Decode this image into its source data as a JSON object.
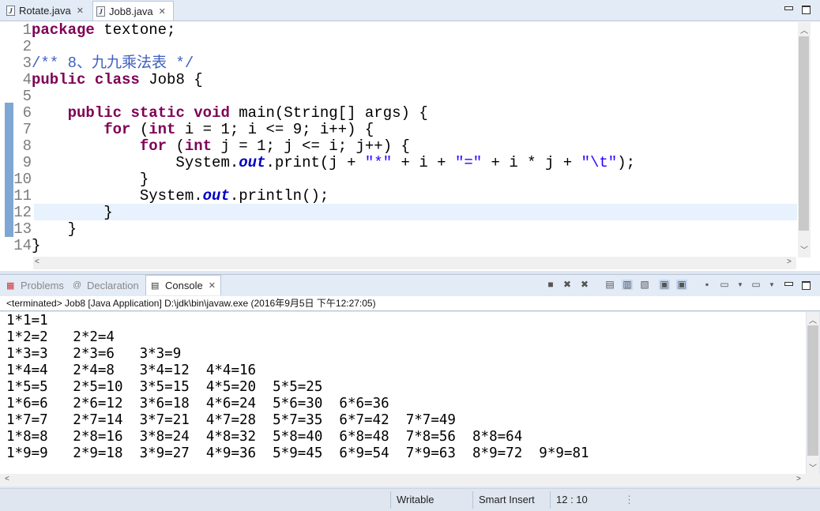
{
  "editor": {
    "tabs": [
      {
        "label": "Rotate.java",
        "icon": "java-file-icon",
        "active": false
      },
      {
        "label": "Job8.java",
        "icon": "java-file-icon",
        "active": true
      }
    ],
    "close_glyph": "✕",
    "line_numbers": [
      "1",
      "2",
      "3",
      "4",
      "5",
      "6",
      "7",
      "8",
      "9",
      "10",
      "11",
      "12",
      "13",
      "14"
    ],
    "cursor_line": 12
  },
  "console": {
    "tabs": [
      {
        "label": "Problems",
        "icon": "problems-icon"
      },
      {
        "label": "Declaration",
        "icon": "declaration-icon"
      },
      {
        "label": "Console",
        "icon": "console-icon"
      }
    ],
    "terminated": "<terminated> Job8 [Java Application] D:\\jdk\\bin\\javaw.exe (2016年9月5日 下午12:27:05)",
    "output": [
      "1*1=1",
      "1*2=2   2*2=4",
      "1*3=3   2*3=6   3*3=9",
      "1*4=4   2*4=8   3*4=12  4*4=16",
      "1*5=5   2*5=10  3*5=15  4*5=20  5*5=25",
      "1*6=6   2*6=12  3*6=18  4*6=24  5*6=30  6*6=36",
      "1*7=7   2*7=14  3*7=21  4*7=28  5*7=35  6*7=42  7*7=49",
      "1*8=8   2*8=16  3*8=24  4*8=32  5*8=40  6*8=48  7*8=56  8*8=64",
      "1*9=9   2*9=18  3*9=27  4*9=36  5*9=45  6*9=54  7*9=63  8*9=72  9*9=81"
    ]
  },
  "status": {
    "mode": "Writable",
    "insert": "Smart Insert",
    "position": "12 : 10"
  }
}
